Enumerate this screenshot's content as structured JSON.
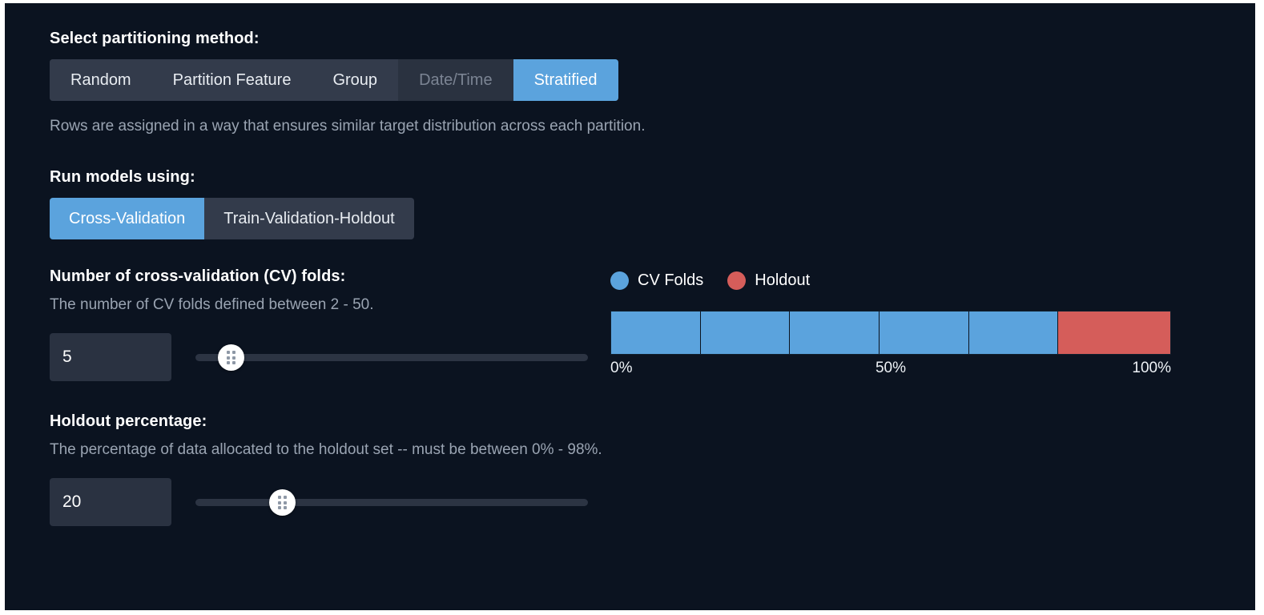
{
  "theme": {
    "background": "#0b1320",
    "accent_blue": "#5ba3dd",
    "holdout_red": "#d55d5a",
    "control_bg": "#333b4b",
    "input_bg": "#2a3241",
    "muted_text": "#9aa4b2"
  },
  "partition_method": {
    "label": "Select partitioning method:",
    "options": [
      {
        "label": "Random",
        "state": "normal"
      },
      {
        "label": "Partition Feature",
        "state": "normal"
      },
      {
        "label": "Group",
        "state": "normal"
      },
      {
        "label": "Date/Time",
        "state": "disabled"
      },
      {
        "label": "Stratified",
        "state": "selected"
      }
    ],
    "description": "Rows are assigned in a way that ensures similar target distribution across each partition."
  },
  "run_models": {
    "label": "Run models using:",
    "options": [
      {
        "label": "Cross-Validation",
        "state": "selected"
      },
      {
        "label": "Train-Validation-Holdout",
        "state": "normal"
      }
    ]
  },
  "cv_folds": {
    "label": "Number of cross-validation (CV) folds:",
    "description": "The number of CV folds defined between 2 - 50.",
    "value": "5",
    "placeholder": "5",
    "min": 2,
    "max": 50,
    "slider_percent": 9
  },
  "holdout": {
    "label": "Holdout percentage:",
    "description": "The percentage of data allocated to the holdout set -- must be between 0% - 98%.",
    "value": "20",
    "placeholder": "20",
    "min": 0,
    "max": 98,
    "slider_percent": 22
  },
  "legend": [
    {
      "label": "CV Folds",
      "color": "#5ba3dd"
    },
    {
      "label": "Holdout",
      "color": "#d55d5a"
    }
  ],
  "chart_data": {
    "type": "bar",
    "title": "",
    "orientation": "horizontal-stacked",
    "xlabel": "",
    "ylabel": "",
    "xlim": [
      0,
      100
    ],
    "grid": false,
    "legend_position": "top-left",
    "axis_ticks": [
      "0%",
      "50%",
      "100%"
    ],
    "categories": [
      "CV Fold 1",
      "CV Fold 2",
      "CV Fold 3",
      "CV Fold 4",
      "CV Fold 5",
      "Holdout"
    ],
    "values": [
      16,
      16,
      16,
      16,
      16,
      20
    ],
    "colors": [
      "#5ba3dd",
      "#5ba3dd",
      "#5ba3dd",
      "#5ba3dd",
      "#5ba3dd",
      "#d55d5a"
    ],
    "series": [
      {
        "name": "CV Folds",
        "values": [
          16,
          16,
          16,
          16,
          16
        ],
        "color": "#5ba3dd",
        "total": 80
      },
      {
        "name": "Holdout",
        "values": [
          20
        ],
        "color": "#d55d5a",
        "total": 20
      }
    ]
  }
}
